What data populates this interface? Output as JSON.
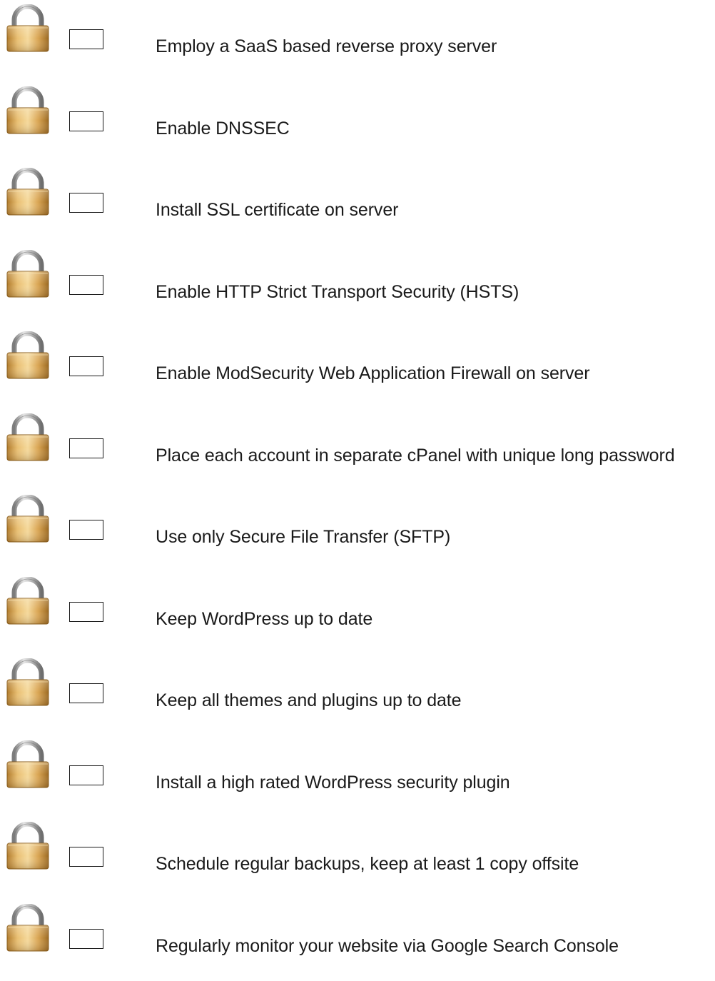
{
  "icons": {
    "item_icon": "padlock-icon",
    "lock_body_color": "#c9953a",
    "lock_shackle_color": "#9a9a9a"
  },
  "items": [
    {
      "label": "Employ a SaaS based reverse proxy server",
      "checked": false
    },
    {
      "label": "Enable DNSSEC",
      "checked": false
    },
    {
      "label": "Install SSL certificate on server",
      "checked": false
    },
    {
      "label": "Enable HTTP Strict Transport Security (HSTS)",
      "checked": false
    },
    {
      "label": "Enable ModSecurity Web Application Firewall on server",
      "checked": false
    },
    {
      "label": "Place each account in separate cPanel with unique long password",
      "checked": false
    },
    {
      "label": "Use only Secure File Transfer (SFTP)",
      "checked": false
    },
    {
      "label": "Keep WordPress up to date",
      "checked": false
    },
    {
      "label": "Keep all themes and plugins up to date",
      "checked": false
    },
    {
      "label": "Install a high rated WordPress security plugin",
      "checked": false
    },
    {
      "label": "Schedule regular backups, keep at least 1 copy offsite",
      "checked": false
    },
    {
      "label": "Regularly monitor your website via Google Search Console",
      "checked": false
    }
  ]
}
